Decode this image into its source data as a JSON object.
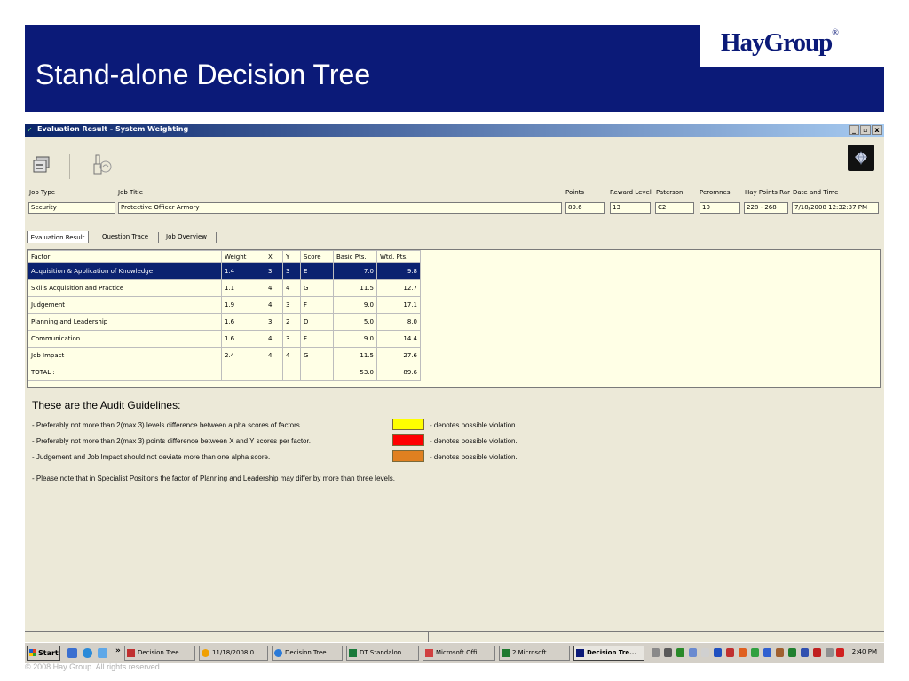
{
  "slide": {
    "title": "Stand-alone Decision Tree",
    "logo_text": "HayGroup",
    "logo_mark": "®",
    "copyright": "© 2008 Hay Group. All rights reserved"
  },
  "window": {
    "title": "Evaluation Result - System Weighting",
    "controls": [
      "_",
      "е",
      "x"
    ]
  },
  "fields": {
    "job_type": {
      "label": "Job Type",
      "value": "Security"
    },
    "job_title": {
      "label": "Job Title",
      "value": "Protective Officer Armory"
    },
    "points": {
      "label": "Points",
      "value": "89.6"
    },
    "reward_level": {
      "label": "Reward Level",
      "value": "13"
    },
    "paterson": {
      "label": "Paterson",
      "value": "C2"
    },
    "peromnes": {
      "label": "Peromnes",
      "value": "10"
    },
    "hay_points_range": {
      "label": "Hay Points Rar",
      "value": "228 - 268"
    },
    "date_time": {
      "label": "Date and Time",
      "value": "7/18/2008 12:32:37 PM"
    }
  },
  "tabs": [
    "Evaluation Result",
    "Question Trace",
    "Job Overview"
  ],
  "table": {
    "columns": [
      "Factor",
      "Weight",
      "X",
      "Y",
      "Score",
      "Basic Pts.",
      "Wtd. Pts."
    ],
    "rows": [
      [
        "Acquisition & Application of Knowledge",
        "1.4",
        "3",
        "3",
        "E",
        "7.0",
        "9.8"
      ],
      [
        "Skills Acquisition and Practice",
        "1.1",
        "4",
        "4",
        "G",
        "11.5",
        "12.7"
      ],
      [
        "Judgement",
        "1.9",
        "4",
        "3",
        "F",
        "9.0",
        "17.1"
      ],
      [
        "Planning and Leadership",
        "1.6",
        "3",
        "2",
        "D",
        "5.0",
        "8.0"
      ],
      [
        "Communication",
        "1.6",
        "4",
        "3",
        "F",
        "9.0",
        "14.4"
      ],
      [
        "Job Impact",
        "2.4",
        "4",
        "4",
        "G",
        "11.5",
        "27.6"
      ],
      [
        "TOTAL :",
        "",
        "",
        "",
        "",
        "53.0",
        "89.6"
      ]
    ],
    "selected_row": 0
  },
  "guidelines": {
    "title": "These are the Audit Guidelines:",
    "items": [
      "- Preferably not more than 2(max 3) levels difference between alpha scores of factors.",
      "- Preferably not more than 2(max 3) points difference between X and Y scores per factor.",
      "- Judgement and Job Impact should not deviate more than one alpha score."
    ],
    "swatch_label": "- denotes possible violation.",
    "swatch_colors": [
      "#ffff00",
      "#ff0000",
      "#e08020"
    ],
    "note": "- Please note that in Specialist Positions the factor of Planning and Leadership may differ by more than three levels."
  },
  "taskbar": {
    "start": "Start",
    "chevron": "»",
    "buttons": [
      "Decision Tree ...",
      "11/18/2008 0...",
      "Decision Tree ...",
      "DT Standalon...",
      "Microsoft Offi...",
      "2 Microsoft ...",
      "Decision Tre..."
    ],
    "clock": "2:40 PM"
  }
}
